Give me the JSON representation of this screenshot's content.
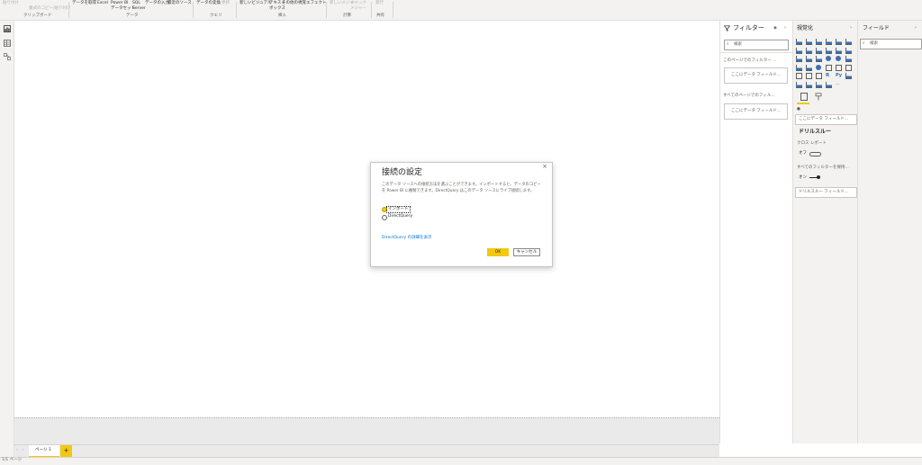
{
  "ribbon": {
    "clipboard_label": "クリップボード",
    "clipboard_items": [
      "貼り付け",
      "書式のコピー/貼り付け"
    ],
    "data_items": [
      "データを取得",
      "Excel",
      "Power BI\nデータセット",
      "SQL\nServer",
      "データの入力",
      "最近のソース"
    ],
    "data_label": "データ",
    "query_items": [
      "データの変換",
      "更新"
    ],
    "query_label": "クエリ",
    "insert_items": [
      "新しいビジュアル",
      "テキスト\nボックス",
      "その他の視覚エフェクト"
    ],
    "insert_label": "挿入",
    "calc_items": [
      "新しいメジャー",
      "クイック\nメジャー"
    ],
    "calc_label": "計算",
    "share_items": [
      "発行"
    ],
    "share_label": "共有"
  },
  "rail": {
    "icons": [
      "report-icon",
      "data-icon",
      "model-icon"
    ]
  },
  "filters": {
    "title": "フィルター",
    "search_placeholder": "検索",
    "page_section": "このページでのフィルター ...",
    "page_drop": "ここにデータ フィールド...",
    "all_section": "すべてのページでのフィル... ",
    "all_drop": "ここにデータ フィールド..."
  },
  "viz": {
    "title": "視覚化",
    "values_drop": "ここにデータ フィールド...",
    "drillthrough_title": "ドリルスルー",
    "cross_report_label": "クロス レポート",
    "cross_report_value": "オフ",
    "keep_filters_label": "すべてのフィルターを保持...",
    "keep_filters_value": "オン",
    "drillthrough_drop": "ドリルスルー フィールド..."
  },
  "fields": {
    "title": "フィールド",
    "search_placeholder": "検索"
  },
  "dialog": {
    "title": "接続の設定",
    "description": "このデータ ソースへの接続方法を選ぶことができます。インポートすると、データのコピーを Power BI に複製できます。DirectQuery はこのデータ ソースにライブ接続します。",
    "option_import": "インポート",
    "option_directquery": "DirectQuery",
    "selected": "インポート",
    "link": "DirectQuery の詳細を表示",
    "ok": "OK",
    "cancel": "キャンセル"
  },
  "tabs": {
    "pages": [
      "ページ 1"
    ],
    "add_label": "+"
  },
  "status": {
    "page_info": "1/1 ページ"
  },
  "colors": {
    "accent": "#f2c811",
    "link": "#0078d4",
    "canvas": "#ffffff",
    "chrome": "#f3f2f1"
  }
}
